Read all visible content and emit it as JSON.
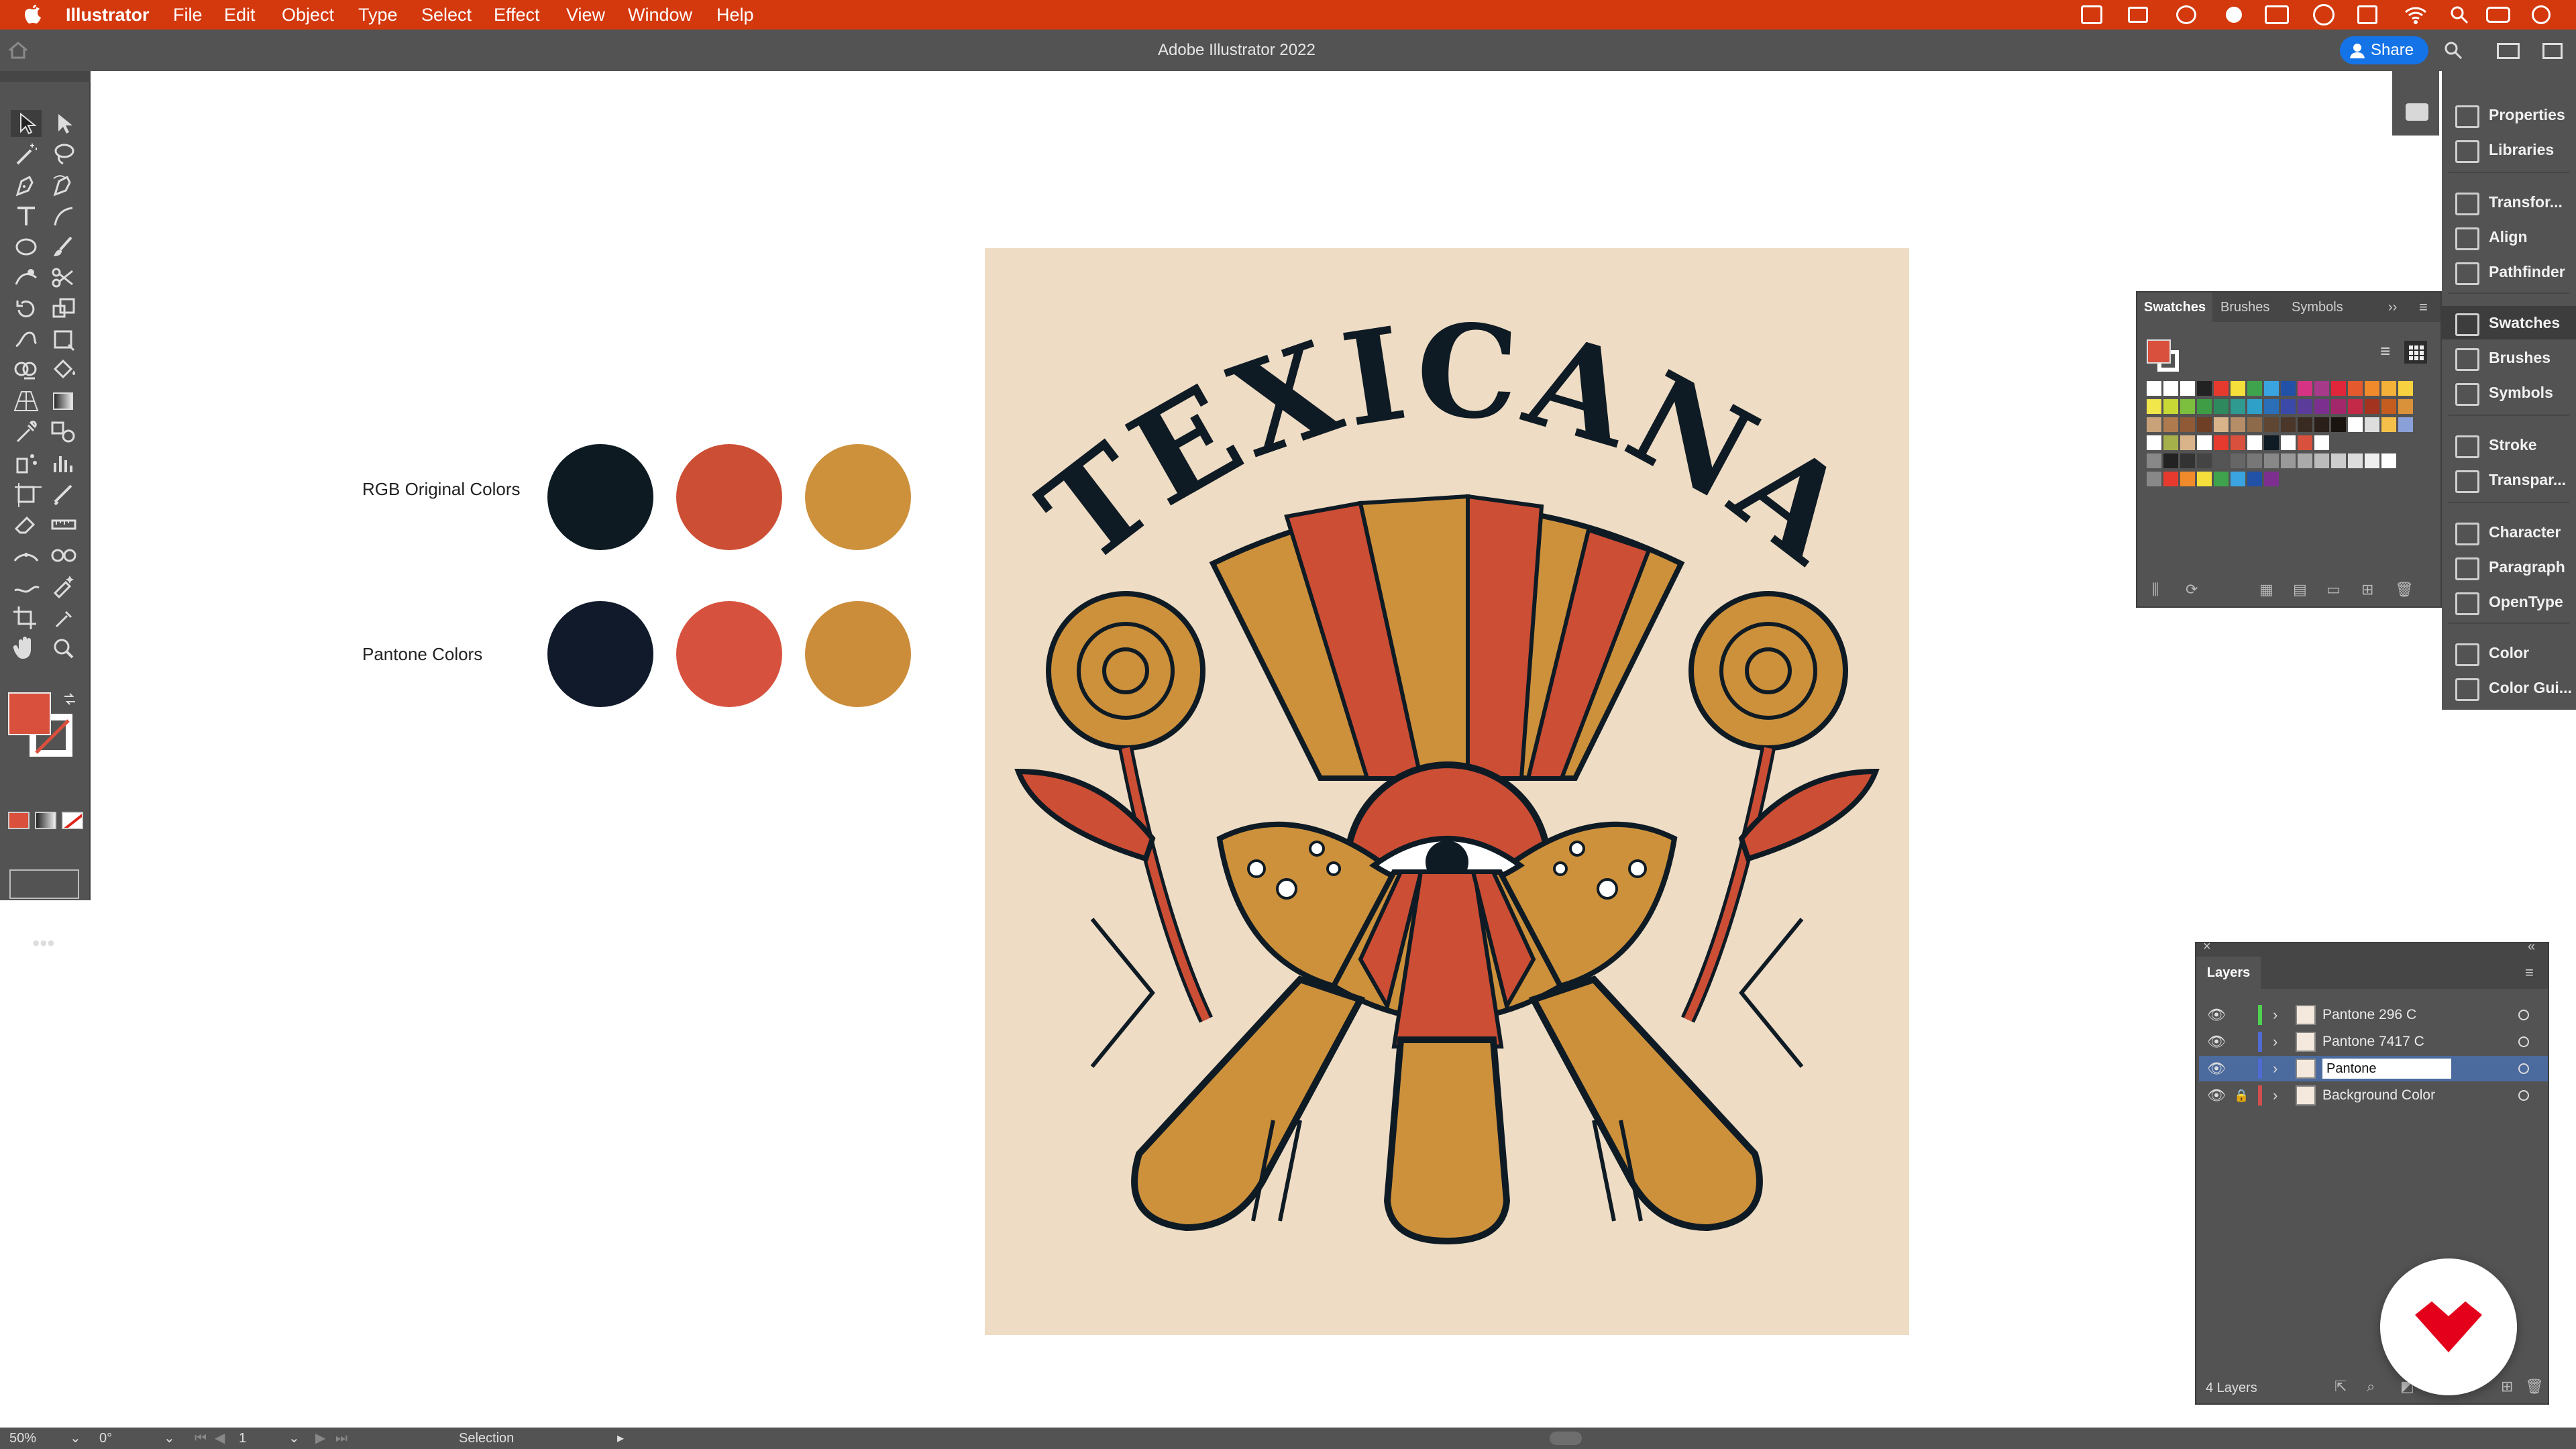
{
  "menubar": {
    "app_name": "Illustrator",
    "items": [
      "File",
      "Edit",
      "Object",
      "Type",
      "Select",
      "Effect",
      "View",
      "Window",
      "Help"
    ]
  },
  "titlebar": {
    "title": "Adobe Illustrator 2022",
    "share_label": "Share"
  },
  "toolbar": {
    "fill_color": "#d9503c",
    "stroke_color": "#ffffff"
  },
  "canvas": {
    "rgb_label": "RGB Original Colors",
    "pantone_label": "Pantone Colors",
    "rgb_colors": [
      "#0d1a22",
      "#cc4e35",
      "#cd913c"
    ],
    "pantone_colors": [
      "#111a2b",
      "#d6523f",
      "#cc8d3a"
    ],
    "artboard_bg": "#eedcc4",
    "artwork_title": "TEXICANA"
  },
  "right_dock": {
    "items": [
      {
        "label": "Properties",
        "icon": "properties-icon"
      },
      {
        "label": "Libraries",
        "icon": "libraries-icon"
      },
      {
        "label": "Transfor...",
        "icon": "transform-icon"
      },
      {
        "label": "Align",
        "icon": "align-icon"
      },
      {
        "label": "Pathfinder",
        "icon": "pathfinder-icon"
      },
      {
        "label": "Swatches",
        "icon": "swatches-icon"
      },
      {
        "label": "Brushes",
        "icon": "brushes-icon"
      },
      {
        "label": "Symbols",
        "icon": "symbols-icon"
      },
      {
        "label": "Stroke",
        "icon": "stroke-icon"
      },
      {
        "label": "Transpar...",
        "icon": "transparency-icon"
      },
      {
        "label": "Character",
        "icon": "character-icon"
      },
      {
        "label": "Paragraph",
        "icon": "paragraph-icon"
      },
      {
        "label": "OpenType",
        "icon": "opentype-icon"
      },
      {
        "label": "Color",
        "icon": "color-icon"
      },
      {
        "label": "Color Gui...",
        "icon": "color-guide-icon"
      }
    ]
  },
  "swatches_panel": {
    "tabs": [
      "Swatches",
      "Brushes",
      "Symbols"
    ]
  },
  "layers_panel": {
    "title": "Layers",
    "rows": [
      {
        "name": "Pantone 296 C",
        "color": "#4fd34f",
        "locked": false
      },
      {
        "name": "Pantone 7417 C",
        "color": "#4f6bd3",
        "locked": false
      },
      {
        "name": "Pantone",
        "color": "#4f6bd3",
        "locked": false,
        "editing": true
      },
      {
        "name": "Background Color",
        "color": "#d34f4f",
        "locked": true
      }
    ],
    "count_label": "4 Layers"
  },
  "statusbar": {
    "zoom": "50%",
    "rotation": "0°",
    "artboard": "1",
    "tool": "Selection"
  }
}
